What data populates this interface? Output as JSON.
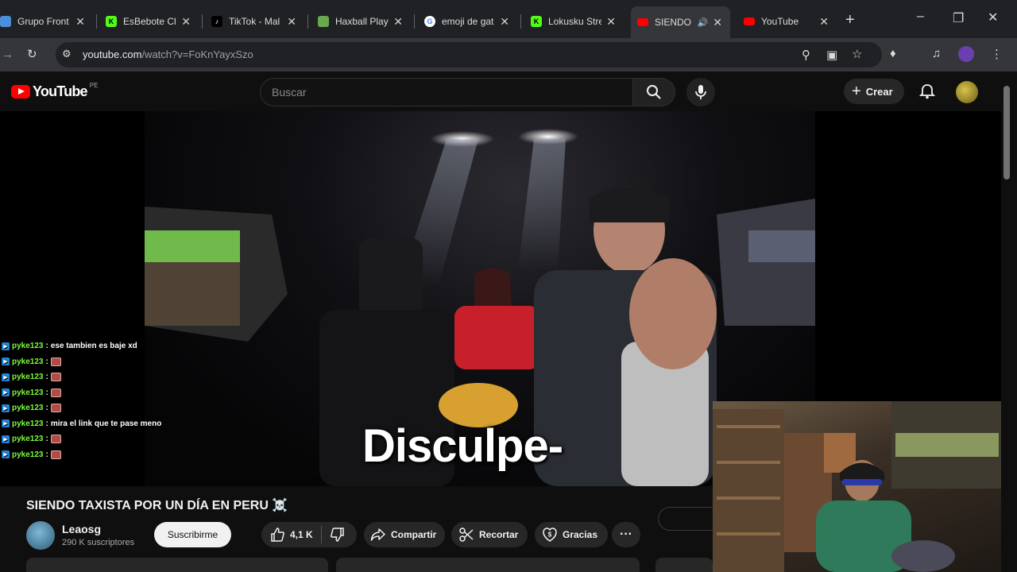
{
  "browser": {
    "tabs": [
      {
        "title": "Grupo Front",
        "icon": "group-icon",
        "color": "#4a8fd9"
      },
      {
        "title": "EsBebote Cli",
        "icon": "kick-icon",
        "color": "#53fc18"
      },
      {
        "title": "TikTok - Mal",
        "icon": "tiktok-icon",
        "color": "#000000"
      },
      {
        "title": "Haxball Play",
        "icon": "haxball-icon",
        "color": "#6aa84f"
      },
      {
        "title": "emoji de gat",
        "icon": "google-icon",
        "color": "#ffffff"
      },
      {
        "title": "Lokusku Stre",
        "icon": "kick-icon",
        "color": "#53fc18"
      },
      {
        "title": "SIENDO",
        "icon": "youtube-icon",
        "color": "#ff0000"
      },
      {
        "title": "YouTube",
        "icon": "youtube-icon",
        "color": "#ff0000"
      }
    ],
    "url_host": "youtube.com",
    "url_path": "/watch?v=FoKnYayxSzo"
  },
  "youtube": {
    "logo_text": "YouTube",
    "country_code": "PE",
    "search_placeholder": "Buscar",
    "create_label": "Crear"
  },
  "video": {
    "subtitle": "Disculpe-",
    "title": "SIENDO TAXISTA POR UN DÍA EN PERU ☠️",
    "channel_name": "Leaosg",
    "channel_subs": "290 K suscriptores",
    "subscribe_label": "Suscribirme",
    "likes": "4,1 K",
    "share_label": "Compartir",
    "clip_label": "Recortar",
    "thanks_label": "Gracias"
  },
  "chat": [
    {
      "user": "pyke123",
      "message": "ese tambien es baje xd",
      "emote": false
    },
    {
      "user": "pyke123",
      "message": "",
      "emote": true
    },
    {
      "user": "pyke123",
      "message": "",
      "emote": true
    },
    {
      "user": "pyke123",
      "message": "",
      "emote": true
    },
    {
      "user": "pyke123",
      "message": "",
      "emote": true
    },
    {
      "user": "pyke123",
      "message": "mira el link que te pase meno",
      "emote": false
    },
    {
      "user": "pyke123",
      "message": "",
      "emote": true
    },
    {
      "user": "pyke123",
      "message": "",
      "emote": true
    }
  ]
}
